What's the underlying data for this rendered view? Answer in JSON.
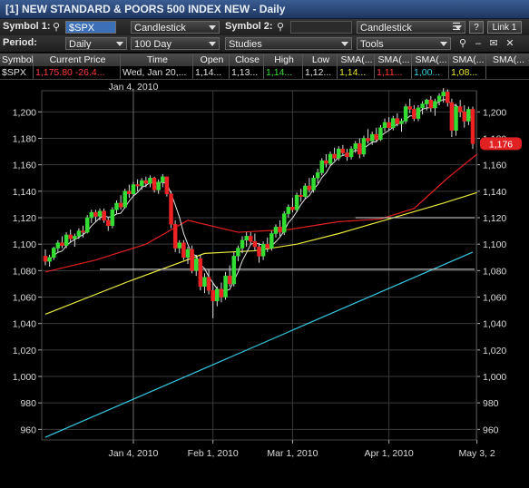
{
  "window": {
    "title": "[1] NEW STANDARD & POORS 500 INDEX NEW - Daily"
  },
  "toolbar": {
    "symbol1_label": "Symbol 1:",
    "symbol1_value": "$SPX",
    "chart_type_1": "Candlestick",
    "symbol2_label": "Symbol 2:",
    "symbol2_value": "",
    "chart_type_2": "Candlestick",
    "help_label": "?",
    "link_label": "Link 1",
    "period_label": "Period:",
    "period_value": "Daily",
    "range_value": "100 Day",
    "studies_value": "Studies",
    "tools_value": "Tools"
  },
  "quote_table": {
    "headers": [
      "Symbol",
      "Current Price",
      "Time",
      "Open",
      "Close",
      "High",
      "Low",
      "SMA(...",
      "SMA(...",
      "SMA(...",
      "SMA(..."
    ],
    "row": [
      "$SPX",
      "1,175.80",
      "-26.4...",
      "Wed, Jan 20,...",
      "1,14...",
      "1,13...",
      "1,14...",
      "1,12...",
      "1,14...",
      "1,11...",
      "1,00...",
      "1,08..."
    ],
    "colors": {
      "price": "#ff3b3b",
      "high": "#37e037",
      "sma1": "#e8e830",
      "sma2": "#ff3b3b",
      "sma3": "#35d0e0",
      "sma4": "#e8e830"
    }
  },
  "chart_data": {
    "type": "candlestick",
    "crosshair_label": "Jan 4, 2010",
    "last_price_label": "1,176",
    "ylim": [
      952,
      1216
    ],
    "y_ticks": [
      960,
      980,
      1000,
      1020,
      1040,
      1060,
      1080,
      1100,
      1120,
      1140,
      1160,
      1180,
      1200
    ],
    "y_tick_labels": [
      "960",
      "980",
      "1,000",
      "1,020",
      "1,040",
      "1,060",
      "1,080",
      "1,100",
      "1,120",
      "1,140",
      "1,160",
      "1,180",
      "1,200"
    ],
    "x_tick_labels": [
      {
        "label": "Jan 4, 2010",
        "index": 21
      },
      {
        "label": "Feb 1, 2010",
        "index": 40
      },
      {
        "label": "Mar 1, 2010",
        "index": 59
      },
      {
        "label": "Apr 1, 2010",
        "index": 82
      },
      {
        "label": "May 3, 2",
        "index": 103
      }
    ],
    "h_lines": [
      1120,
      1081
    ],
    "colors": {
      "up": "#33dd33",
      "down": "#ee2222",
      "sma_short": "#e8e8e8",
      "sma_50": "#e02020",
      "sma_100": "#e8e840",
      "sma_200": "#35c8e0",
      "grid": "#3a3a3a",
      "hline": "#dcdcdc"
    },
    "candles": [
      [
        1091,
        1096,
        1084,
        1087
      ],
      [
        1087,
        1092,
        1083,
        1090
      ],
      [
        1090,
        1098,
        1088,
        1097
      ],
      [
        1097,
        1103,
        1094,
        1101
      ],
      [
        1101,
        1106,
        1097,
        1099
      ],
      [
        1099,
        1109,
        1097,
        1107
      ],
      [
        1107,
        1111,
        1101,
        1104
      ],
      [
        1104,
        1108,
        1098,
        1106
      ],
      [
        1106,
        1112,
        1104,
        1110
      ],
      [
        1110,
        1114,
        1105,
        1109
      ],
      [
        1109,
        1122,
        1108,
        1120
      ],
      [
        1120,
        1126,
        1116,
        1124
      ],
      [
        1124,
        1126,
        1117,
        1121
      ],
      [
        1121,
        1127,
        1118,
        1125
      ],
      [
        1125,
        1127,
        1116,
        1118
      ],
      [
        1118,
        1120,
        1110,
        1114
      ],
      [
        1114,
        1128,
        1112,
        1126
      ],
      [
        1126,
        1133,
        1123,
        1131
      ],
      [
        1131,
        1137,
        1126,
        1128
      ],
      [
        1128,
        1142,
        1127,
        1140
      ],
      [
        1140,
        1145,
        1135,
        1138
      ],
      [
        1138,
        1147,
        1136,
        1145
      ],
      [
        1145,
        1149,
        1140,
        1144
      ],
      [
        1144,
        1150,
        1141,
        1148
      ],
      [
        1148,
        1151,
        1143,
        1146
      ],
      [
        1146,
        1152,
        1143,
        1150
      ],
      [
        1150,
        1151,
        1139,
        1141
      ],
      [
        1141,
        1149,
        1138,
        1147
      ],
      [
        1147,
        1153,
        1143,
        1151
      ],
      [
        1151,
        1151,
        1136,
        1138
      ],
      [
        1138,
        1140,
        1112,
        1115
      ],
      [
        1115,
        1118,
        1094,
        1097
      ],
      [
        1097,
        1103,
        1093,
        1101
      ],
      [
        1101,
        1103,
        1088,
        1090
      ],
      [
        1090,
        1098,
        1085,
        1096
      ],
      [
        1096,
        1099,
        1078,
        1080
      ],
      [
        1080,
        1092,
        1076,
        1089
      ],
      [
        1089,
        1092,
        1065,
        1068
      ],
      [
        1068,
        1078,
        1063,
        1075
      ],
      [
        1075,
        1081,
        1062,
        1065
      ],
      [
        1065,
        1071,
        1044,
        1057
      ],
      [
        1057,
        1068,
        1053,
        1066
      ],
      [
        1066,
        1071,
        1056,
        1060
      ],
      [
        1060,
        1079,
        1058,
        1076
      ],
      [
        1076,
        1084,
        1068,
        1070
      ],
      [
        1070,
        1094,
        1068,
        1091
      ],
      [
        1091,
        1099,
        1087,
        1097
      ],
      [
        1097,
        1106,
        1093,
        1103
      ],
      [
        1103,
        1109,
        1098,
        1106
      ],
      [
        1106,
        1109,
        1100,
        1102
      ],
      [
        1102,
        1108,
        1095,
        1098
      ],
      [
        1098,
        1101,
        1086,
        1091
      ],
      [
        1091,
        1102,
        1088,
        1100
      ],
      [
        1100,
        1105,
        1094,
        1097
      ],
      [
        1097,
        1110,
        1095,
        1108
      ],
      [
        1108,
        1115,
        1105,
        1113
      ],
      [
        1113,
        1118,
        1106,
        1109
      ],
      [
        1109,
        1125,
        1107,
        1123
      ],
      [
        1123,
        1130,
        1120,
        1128
      ],
      [
        1128,
        1135,
        1124,
        1126
      ],
      [
        1126,
        1139,
        1124,
        1137
      ],
      [
        1137,
        1142,
        1132,
        1136
      ],
      [
        1136,
        1146,
        1134,
        1144
      ],
      [
        1144,
        1150,
        1139,
        1141
      ],
      [
        1141,
        1152,
        1139,
        1150
      ],
      [
        1150,
        1157,
        1146,
        1154
      ],
      [
        1154,
        1165,
        1152,
        1163
      ],
      [
        1163,
        1168,
        1158,
        1161
      ],
      [
        1161,
        1170,
        1159,
        1168
      ],
      [
        1168,
        1173,
        1163,
        1165
      ],
      [
        1165,
        1174,
        1163,
        1172
      ],
      [
        1172,
        1175,
        1167,
        1169
      ],
      [
        1169,
        1172,
        1163,
        1166
      ],
      [
        1166,
        1174,
        1164,
        1172
      ],
      [
        1172,
        1178,
        1169,
        1176
      ],
      [
        1176,
        1180,
        1165,
        1168
      ],
      [
        1168,
        1182,
        1166,
        1180
      ],
      [
        1180,
        1187,
        1176,
        1178
      ],
      [
        1178,
        1185,
        1175,
        1183
      ],
      [
        1183,
        1188,
        1177,
        1179
      ],
      [
        1179,
        1190,
        1178,
        1188
      ],
      [
        1188,
        1195,
        1185,
        1192
      ],
      [
        1192,
        1196,
        1186,
        1188
      ],
      [
        1188,
        1197,
        1186,
        1195
      ],
      [
        1195,
        1199,
        1189,
        1191
      ],
      [
        1191,
        1195,
        1185,
        1193
      ],
      [
        1193,
        1206,
        1191,
        1204
      ],
      [
        1204,
        1210,
        1199,
        1202
      ],
      [
        1202,
        1205,
        1193,
        1195
      ],
      [
        1195,
        1205,
        1193,
        1203
      ],
      [
        1203,
        1208,
        1198,
        1206
      ],
      [
        1206,
        1210,
        1201,
        1209
      ],
      [
        1209,
        1212,
        1200,
        1203
      ],
      [
        1203,
        1210,
        1197,
        1208
      ],
      [
        1208,
        1214,
        1205,
        1212
      ],
      [
        1212,
        1218,
        1207,
        1215
      ],
      [
        1215,
        1217,
        1204,
        1207
      ],
      [
        1207,
        1210,
        1181,
        1186
      ],
      [
        1186,
        1206,
        1182,
        1204
      ],
      [
        1204,
        1209,
        1196,
        1200
      ],
      [
        1200,
        1205,
        1188,
        1193
      ],
      [
        1193,
        1204,
        1190,
        1202
      ],
      [
        1202,
        1204,
        1172,
        1176
      ]
    ],
    "sma_200": {
      "start": 954,
      "end": 1094
    },
    "sma_100_points": [
      [
        0,
        1047
      ],
      [
        20,
        1072
      ],
      [
        38,
        1093
      ],
      [
        50,
        1095
      ],
      [
        60,
        1100
      ],
      [
        70,
        1108
      ],
      [
        82,
        1119
      ],
      [
        95,
        1131
      ],
      [
        103,
        1139
      ]
    ],
    "sma_50_points": [
      [
        0,
        1079
      ],
      [
        12,
        1088
      ],
      [
        24,
        1100
      ],
      [
        34,
        1118
      ],
      [
        46,
        1109
      ],
      [
        58,
        1111
      ],
      [
        70,
        1117
      ],
      [
        80,
        1119
      ],
      [
        88,
        1127
      ],
      [
        96,
        1150
      ],
      [
        103,
        1168
      ]
    ]
  }
}
